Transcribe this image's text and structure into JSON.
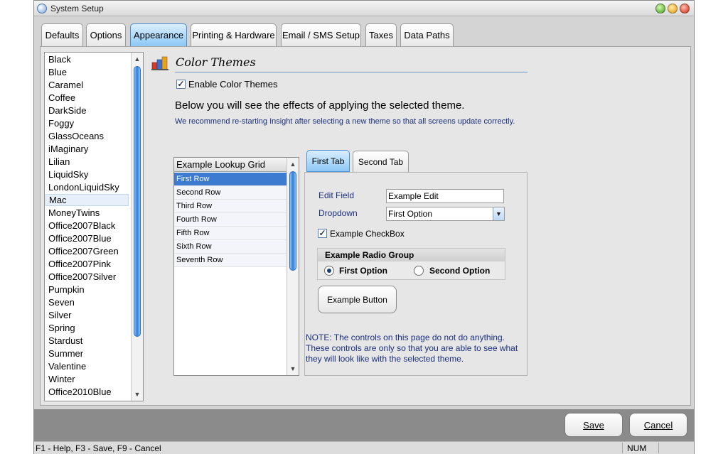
{
  "window": {
    "title": "System Setup"
  },
  "tabs": [
    "Defaults",
    "Options",
    "Appearance",
    "Printing & Hardware",
    "Email / SMS Setup",
    "Taxes",
    "Data Paths"
  ],
  "active_tab": "Appearance",
  "themes": [
    "Black",
    "Blue",
    "Caramel",
    "Coffee",
    "DarkSide",
    "Foggy",
    "GlassOceans",
    "iMaginary",
    "Lilian",
    "LiquidSky",
    "LondonLiquidSky",
    "Mac",
    "MoneyTwins",
    "Office2007Black",
    "Office2007Blue",
    "Office2007Green",
    "Office2007Pink",
    "Office2007Silver",
    "Pumpkin",
    "Seven",
    "Silver",
    "Spring",
    "Stardust",
    "Summer",
    "Valentine",
    "Winter",
    "Office2010Blue"
  ],
  "selected_theme": "Mac",
  "section": {
    "title": "Color Themes",
    "enable_label": "Enable Color Themes",
    "enable_checked": true,
    "intro": "Below you will see the effects of applying the selected theme.",
    "recommendation": "We recommend re-starting Insight after selecting a new theme so that all screens update correctly."
  },
  "grid": {
    "header": "Example Lookup Grid",
    "rows": [
      "First Row",
      "Second Row",
      "Third Row",
      "Fourth Row",
      "Fifth Row",
      "Sixth Row",
      "Seventh Row"
    ],
    "selected_row": "First Row"
  },
  "demo_tabs": [
    "First Tab",
    "Second Tab"
  ],
  "demo": {
    "edit_label": "Edit Field",
    "edit_value": "Example Edit",
    "dropdown_label": "Dropdown",
    "dropdown_value": "First Option",
    "checkbox_label": "Example CheckBox",
    "checkbox_checked": true,
    "radio_group_title": "Example Radio Group",
    "radio_options": [
      "First Option",
      "Second Option"
    ],
    "radio_selected": "First Option",
    "button_label": "Example Button",
    "note": [
      "NOTE: The controls on this page do not do anything.",
      "These controls are only so that you are able to see what",
      "they will look like with the selected theme."
    ]
  },
  "footer": {
    "save_label": "Save",
    "cancel_label": "Cancel"
  },
  "status": {
    "help": "F1 - Help, F3 - Save, F9 - Cancel",
    "num": "NUM"
  },
  "colors": {
    "accent_blue": "#3d7bd0",
    "note_text": "#1b2f7a",
    "tab_active": "#8dc8f5"
  }
}
